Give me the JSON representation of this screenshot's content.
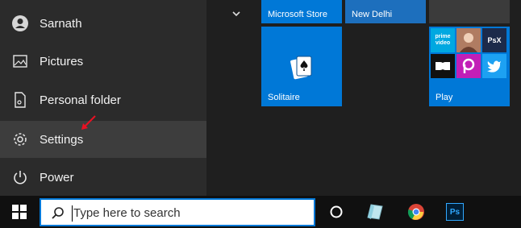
{
  "start_menu": {
    "items": [
      {
        "label": "Sarnath",
        "icon": "user-icon"
      },
      {
        "label": "Pictures",
        "icon": "pictures-icon"
      },
      {
        "label": "Personal folder",
        "icon": "document-icon"
      },
      {
        "label": "Settings",
        "icon": "gear-icon"
      },
      {
        "label": "Power",
        "icon": "power-icon"
      }
    ]
  },
  "tiles": {
    "store": "Microsoft Store",
    "weather": "New Delhi",
    "solitaire": "Solitaire",
    "play": "Play",
    "play_apps": {
      "prime": "prime video",
      "photoshop_express": "PsX"
    }
  },
  "taskbar": {
    "search_placeholder": "Type here to search",
    "apps": [
      "cortana-icon",
      "notes-icon",
      "chrome-icon",
      "photoshop-icon"
    ],
    "photoshop_label": "Ps"
  },
  "colors": {
    "accent": "#0078d7",
    "rail_bg": "#2b2b2b",
    "highlight": "#3d3d3d",
    "annotation_arrow": "#e81123"
  }
}
